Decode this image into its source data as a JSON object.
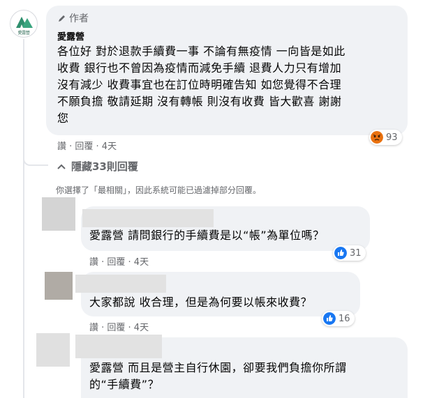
{
  "main_comment": {
    "avatar_text": "愛露營",
    "author_tag": "作者",
    "name": "愛露營",
    "lines": [
      "各位好 對於退款手續費一事 不論有無疫情 一向皆是如此",
      "收費 銀行也不曾因為疫情而減免手續 退費人力只有增加",
      "沒有減少 收費事宜也在訂位時明確告知 如您覺得不合理",
      "不願負擔 敬請延期 沒有轉帳 則沒有收費 皆大歡喜 謝謝",
      "您"
    ],
    "actions": "讚 · 回覆 · 4天",
    "reaction_count": "93",
    "reaction_icon": "angry-icon"
  },
  "hidden_replies": "隱藏33則回覆",
  "filter_notice": "你選擇了「最相關」，因此系統可能已過濾掉部分回覆。",
  "replies": [
    {
      "text": "愛露營 請問銀行的手續費是以“帳”為單位嗎？",
      "actions": "讚 · 回覆 · 4天",
      "reaction_count": "31",
      "reaction_icon": "like-icon"
    },
    {
      "text": "大家都說 收合理，但是為何要以帳來收費？",
      "actions": "讚 · 回覆 · 4天",
      "reaction_count": "16",
      "reaction_icon": "like-icon"
    },
    {
      "lines": [
        "愛露營 而且是營主自行休園，卻要我們負擔你所謂",
        "的“手續費”？"
      ]
    }
  ],
  "colors": {
    "bubble": "#f0f2f5",
    "meta_text": "#65676b",
    "like_blue": "#1877f2",
    "angry_orange": "#e9710f"
  }
}
